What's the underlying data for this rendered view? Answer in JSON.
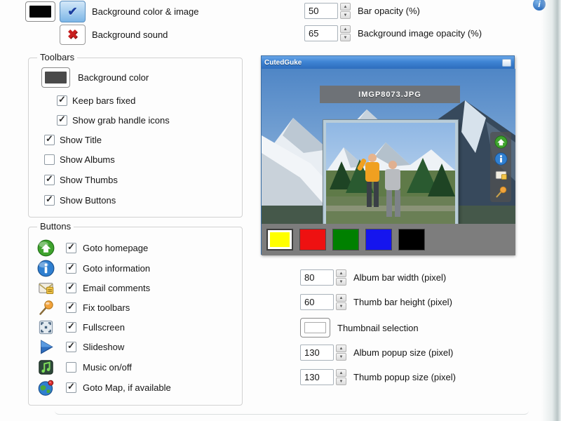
{
  "header": {
    "bg_color_image_label": "Background color & image",
    "bg_sound_label": "Background sound",
    "bg_swatch_color": "#050505",
    "bar_opacity": {
      "value": "50",
      "label": "Bar opacity (%)"
    },
    "bg_image_opacity": {
      "value": "65",
      "label": "Background image opacity (%)"
    },
    "info_icon_glyph": "i"
  },
  "toolbars_group": {
    "title": "Toolbars",
    "background_color_label": "Background color",
    "background_color_swatch": "#4a4a4a",
    "items": [
      {
        "label": "Keep bars fixed",
        "checked": true
      },
      {
        "label": "Show grab handle icons",
        "checked": true
      },
      {
        "label": "Show Title",
        "checked": true
      },
      {
        "label": "Show Albums",
        "checked": false
      },
      {
        "label": "Show Thumbs",
        "checked": true
      },
      {
        "label": "Show Buttons",
        "checked": true
      }
    ]
  },
  "buttons_group": {
    "title": "Buttons",
    "items": [
      {
        "icon": "homepage-icon",
        "label": "Goto homepage",
        "checked": true
      },
      {
        "icon": "information-icon",
        "label": "Goto information",
        "checked": true
      },
      {
        "icon": "email-icon",
        "label": "Email comments",
        "checked": true
      },
      {
        "icon": "pin-icon",
        "label": "Fix toolbars",
        "checked": true
      },
      {
        "icon": "fullscreen-icon",
        "label": "Fullscreen",
        "checked": true
      },
      {
        "icon": "slideshow-icon",
        "label": "Slideshow",
        "checked": true
      },
      {
        "icon": "music-icon",
        "label": "Music on/off",
        "checked": false
      },
      {
        "icon": "map-icon",
        "label": "Goto Map, if available",
        "checked": true
      }
    ]
  },
  "preview": {
    "window_title": "CutedGuke",
    "image_title": "IMGP8073.JPG",
    "palette": [
      "#ffff00",
      "#ee1111",
      "#008000",
      "#1515ee",
      "#000000"
    ],
    "selected_color_index": 0
  },
  "settings": {
    "album_bar_width": {
      "value": "80",
      "label": "Album bar width (pixel)"
    },
    "thumb_bar_height": {
      "value": "60",
      "label": "Thumb bar height (pixel)"
    },
    "thumbnail_selection_label": "Thumbnail selection",
    "thumbnail_selection_swatch": "#ffffff",
    "album_popup_size": {
      "value": "130",
      "label": "Album popup size (pixel)"
    },
    "thumb_popup_size": {
      "value": "130",
      "label": "Thumb popup size (pixel)"
    }
  }
}
